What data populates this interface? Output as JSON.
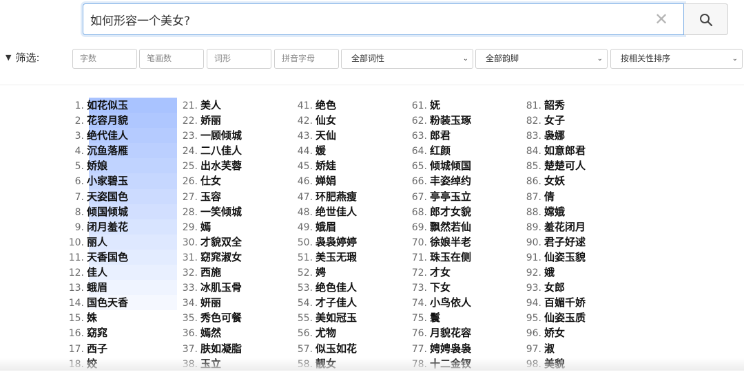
{
  "search": {
    "value": "如何形容一个美女?",
    "placeholder": ""
  },
  "filters": {
    "label": "筛选:",
    "inputs": [
      {
        "placeholder": "字数"
      },
      {
        "placeholder": "笔画数"
      },
      {
        "placeholder": "词形"
      },
      {
        "placeholder": "拼音字母"
      }
    ],
    "selects": [
      {
        "value": "全部词性"
      },
      {
        "value": "全部韵脚"
      },
      {
        "value": "按相关性排序"
      }
    ]
  },
  "results": {
    "highlight_color": "#a9c3ff",
    "columns": [
      [
        {
          "n": "1.",
          "w": "如花似玉"
        },
        {
          "n": "2.",
          "w": "花容月貌"
        },
        {
          "n": "3.",
          "w": "绝代佳人"
        },
        {
          "n": "4.",
          "w": "沉鱼落雁"
        },
        {
          "n": "5.",
          "w": "娇娘"
        },
        {
          "n": "6.",
          "w": "小家碧玉"
        },
        {
          "n": "7.",
          "w": "天姿国色"
        },
        {
          "n": "8.",
          "w": "倾国倾城"
        },
        {
          "n": "9.",
          "w": "闭月羞花"
        },
        {
          "n": "10.",
          "w": "丽人"
        },
        {
          "n": "11.",
          "w": "天香国色"
        },
        {
          "n": "12.",
          "w": "佳人"
        },
        {
          "n": "13.",
          "w": "蛾眉"
        },
        {
          "n": "14.",
          "w": "国色天香"
        },
        {
          "n": "15.",
          "w": "姝"
        },
        {
          "n": "16.",
          "w": "窈窕"
        },
        {
          "n": "17.",
          "w": "西子"
        },
        {
          "n": "18.",
          "w": "姣"
        }
      ],
      [
        {
          "n": "21.",
          "w": "美人"
        },
        {
          "n": "22.",
          "w": "娇丽"
        },
        {
          "n": "23.",
          "w": "一顾倾城"
        },
        {
          "n": "24.",
          "w": "二八佳人"
        },
        {
          "n": "25.",
          "w": "出水芙蓉"
        },
        {
          "n": "26.",
          "w": "仕女"
        },
        {
          "n": "27.",
          "w": "玉容"
        },
        {
          "n": "28.",
          "w": "一笑倾城"
        },
        {
          "n": "29.",
          "w": "嫣"
        },
        {
          "n": "30.",
          "w": "才貌双全"
        },
        {
          "n": "31.",
          "w": "窈窕淑女"
        },
        {
          "n": "32.",
          "w": "西施"
        },
        {
          "n": "33.",
          "w": "冰肌玉骨"
        },
        {
          "n": "34.",
          "w": "妍丽"
        },
        {
          "n": "35.",
          "w": "秀色可餐"
        },
        {
          "n": "36.",
          "w": "嫣然"
        },
        {
          "n": "37.",
          "w": "肤如凝脂"
        },
        {
          "n": "38.",
          "w": "玉立"
        }
      ],
      [
        {
          "n": "41.",
          "w": "绝色"
        },
        {
          "n": "42.",
          "w": "仙女"
        },
        {
          "n": "43.",
          "w": "天仙"
        },
        {
          "n": "44.",
          "w": "媛"
        },
        {
          "n": "45.",
          "w": "娇娃"
        },
        {
          "n": "46.",
          "w": "婵娟"
        },
        {
          "n": "47.",
          "w": "环肥燕瘦"
        },
        {
          "n": "48.",
          "w": "绝世佳人"
        },
        {
          "n": "49.",
          "w": "娥眉"
        },
        {
          "n": "50.",
          "w": "袅袅婷婷"
        },
        {
          "n": "51.",
          "w": "美玉无瑕"
        },
        {
          "n": "52.",
          "w": "娉"
        },
        {
          "n": "53.",
          "w": "绝色佳人"
        },
        {
          "n": "54.",
          "w": "才子佳人"
        },
        {
          "n": "55.",
          "w": "美如冠玉"
        },
        {
          "n": "56.",
          "w": "尤物"
        },
        {
          "n": "57.",
          "w": "似玉如花"
        },
        {
          "n": "58.",
          "w": "靓女"
        }
      ],
      [
        {
          "n": "61.",
          "w": "妩"
        },
        {
          "n": "62.",
          "w": "粉装玉琢"
        },
        {
          "n": "63.",
          "w": "郎君"
        },
        {
          "n": "64.",
          "w": "红颜"
        },
        {
          "n": "65.",
          "w": "倾城倾国"
        },
        {
          "n": "66.",
          "w": "丰姿绰约"
        },
        {
          "n": "67.",
          "w": "亭亭玉立"
        },
        {
          "n": "68.",
          "w": "郎才女貌"
        },
        {
          "n": "69.",
          "w": "飘然若仙"
        },
        {
          "n": "70.",
          "w": "徐娘半老"
        },
        {
          "n": "71.",
          "w": "珠玉在侧"
        },
        {
          "n": "72.",
          "w": "才女"
        },
        {
          "n": "73.",
          "w": "下女"
        },
        {
          "n": "74.",
          "w": "小鸟依人"
        },
        {
          "n": "75.",
          "w": "鬟"
        },
        {
          "n": "76.",
          "w": "月貌花容"
        },
        {
          "n": "77.",
          "w": "娉娉袅袅"
        },
        {
          "n": "78.",
          "w": "十二金钗"
        }
      ],
      [
        {
          "n": "81.",
          "w": "韶秀"
        },
        {
          "n": "82.",
          "w": "女子"
        },
        {
          "n": "83.",
          "w": "袅娜"
        },
        {
          "n": "84.",
          "w": "如意郎君"
        },
        {
          "n": "85.",
          "w": "楚楚可人"
        },
        {
          "n": "86.",
          "w": "女妖"
        },
        {
          "n": "87.",
          "w": "倩"
        },
        {
          "n": "88.",
          "w": "嫦娥"
        },
        {
          "n": "89.",
          "w": "羞花闭月"
        },
        {
          "n": "90.",
          "w": "君子好逑"
        },
        {
          "n": "91.",
          "w": "仙姿玉貌"
        },
        {
          "n": "92.",
          "w": "娥"
        },
        {
          "n": "93.",
          "w": "女郎"
        },
        {
          "n": "94.",
          "w": "百媚千娇"
        },
        {
          "n": "95.",
          "w": "仙姿玉质"
        },
        {
          "n": "96.",
          "w": "娇女"
        },
        {
          "n": "97.",
          "w": "淑"
        },
        {
          "n": "98.",
          "w": "美貌"
        }
      ]
    ]
  }
}
